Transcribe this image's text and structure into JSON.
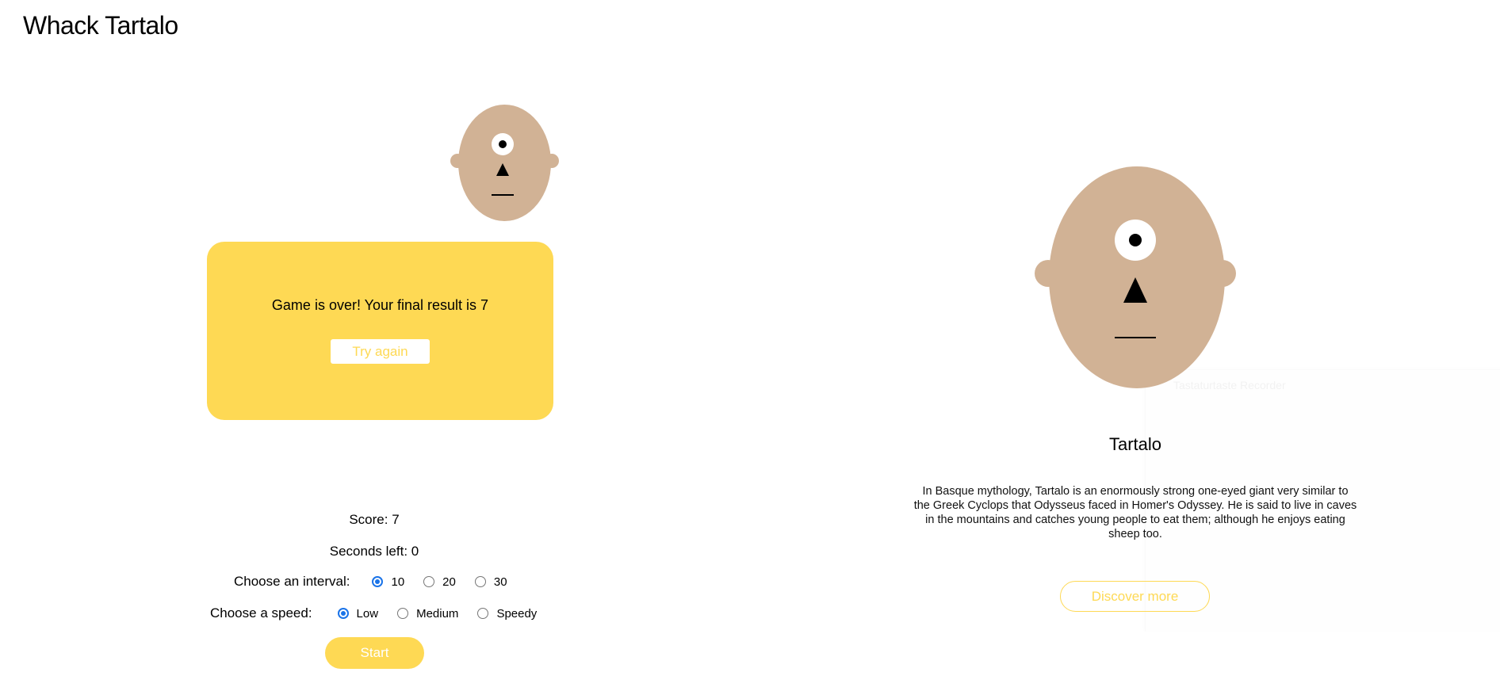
{
  "app": {
    "title": "Whack Tartalo"
  },
  "game_over": {
    "message": "Game is over! Your final result is 7",
    "try_again_label": "Try again"
  },
  "stats": {
    "score_text": "Score: 7",
    "seconds_left_text": "Seconds left: 0"
  },
  "interval": {
    "label": "Choose an interval:",
    "options": [
      "10",
      "20",
      "30"
    ],
    "selected": "10"
  },
  "speed": {
    "label": "Choose a speed:",
    "options": [
      "Low",
      "Medium",
      "Speedy"
    ],
    "selected": "Low"
  },
  "start_label": "Start",
  "info": {
    "title": "Tartalo",
    "description": "In Basque mythology, Tartalo is an enormously strong one-eyed giant very similar to the Greek Cyclops that Odysseus faced in Homer's Odyssey. He is said to live in caves in the mountains and catches young people to eat them; although he enjoys eating sheep too.",
    "discover_label": "Discover more"
  },
  "overlay": {
    "faint_label": "Tastaturtaste Recorder"
  },
  "colors": {
    "accent": "#fed954",
    "skin": "#d1b295",
    "radio_selected": "#1a73e8"
  },
  "icons": {
    "face": "tartalo-cyclops-face"
  }
}
